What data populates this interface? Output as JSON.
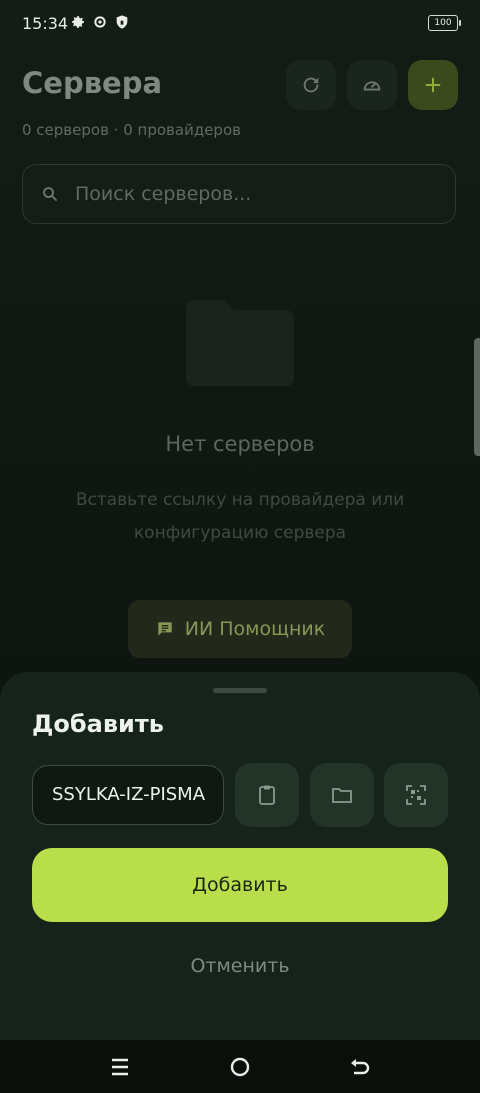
{
  "status_bar": {
    "time": "15:34",
    "battery": "100"
  },
  "header": {
    "title": "Сервера",
    "subtitle": "0 серверов · 0 провайдеров",
    "buttons": [
      "refresh-icon",
      "speedometer-icon",
      "plus-icon"
    ]
  },
  "search": {
    "placeholder": "Поиск серверов..."
  },
  "empty_state": {
    "title": "Нет серверов",
    "description": "Вставьте ссылку на провайдера или конфигурацию сервера",
    "assistant_label": "ИИ Помощник"
  },
  "sheet": {
    "title": "Добавить",
    "link_value": "SSYLKA-IZ-PISMA",
    "icon_buttons": [
      "clipboard-icon",
      "folder-icon",
      "qr-scan-icon"
    ],
    "primary_label": "Добавить",
    "cancel_label": "Отменить"
  },
  "colors": {
    "accent": "#b8de4b",
    "background": "#0f1711",
    "sheet": "#16231b"
  }
}
